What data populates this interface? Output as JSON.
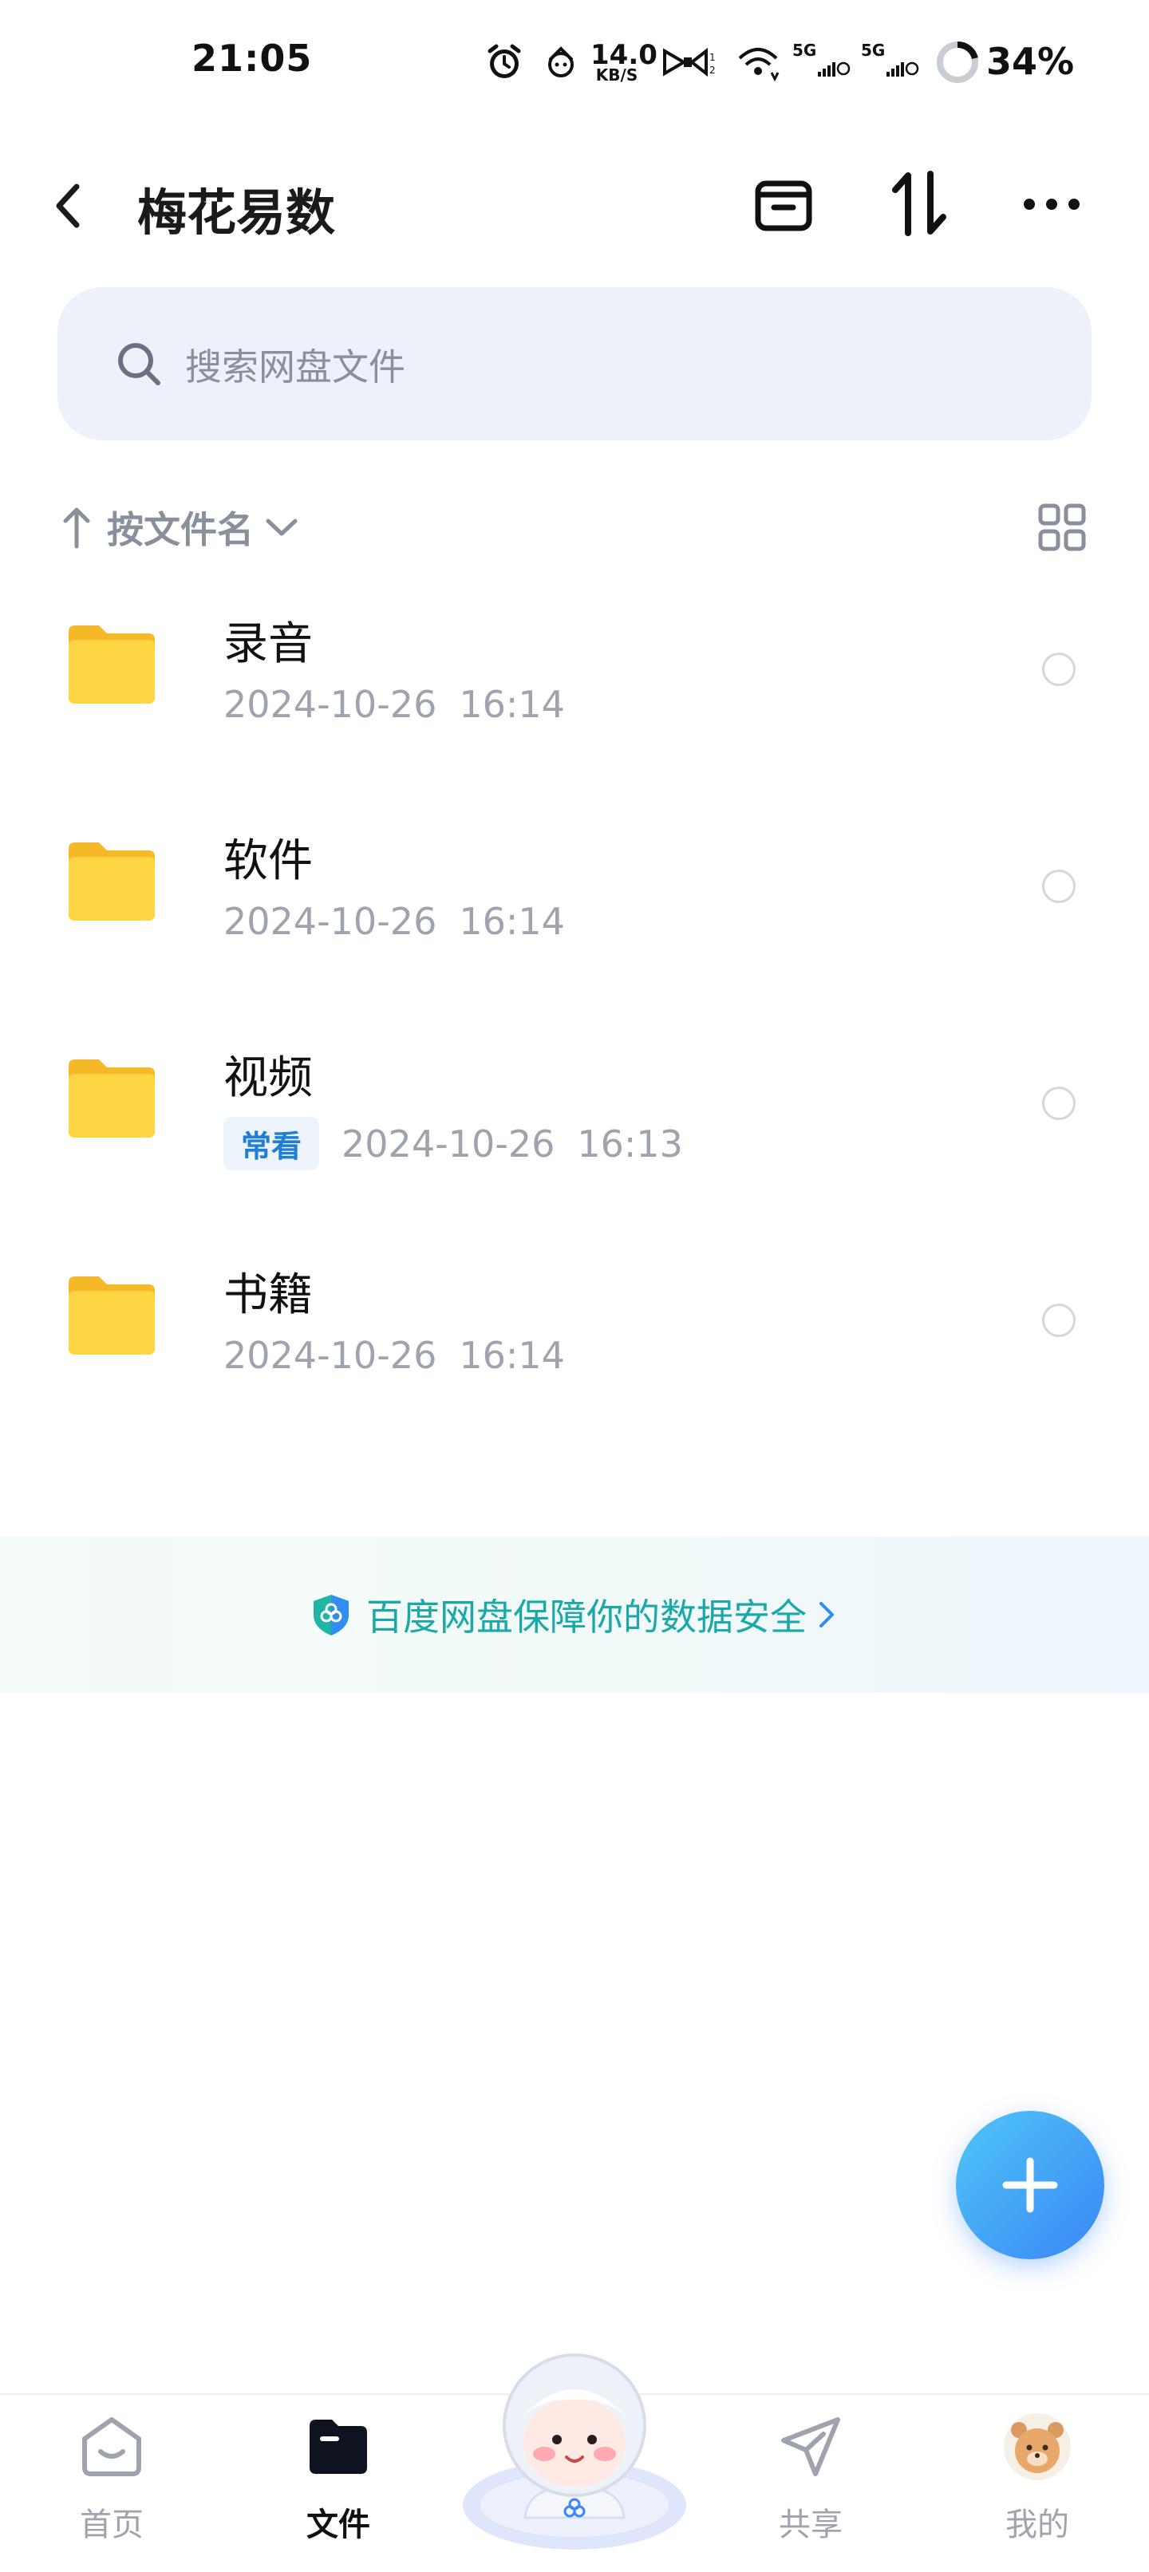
{
  "status_bar": {
    "time": "21:05",
    "net_speed_value": "14.0",
    "net_speed_unit": "KB/S",
    "battery": "34%",
    "icons": [
      "alarm-icon",
      "app-notification-icon",
      "bow-icon",
      "wifi-icon",
      "signal-5g-icon",
      "signal-5g-icon",
      "battery-ring-icon"
    ],
    "signal_label_1": "5G",
    "signal_label_2": "5G"
  },
  "header": {
    "title": "梅花易数",
    "icons": [
      "back-arrow-icon",
      "archive-icon",
      "sort-arrows-icon",
      "more-dots-icon"
    ]
  },
  "search": {
    "placeholder": "搜索网盘文件"
  },
  "sort": {
    "label": "按文件名"
  },
  "files": [
    {
      "name": "录音",
      "date": "2024-10-26",
      "time": "16:14",
      "tag": ""
    },
    {
      "name": "软件",
      "date": "2024-10-26",
      "time": "16:14",
      "tag": ""
    },
    {
      "name": "视频",
      "date": "2024-10-26",
      "time": "16:13",
      "tag": "常看"
    },
    {
      "name": "书籍",
      "date": "2024-10-26",
      "time": "16:14",
      "tag": ""
    }
  ],
  "banner": {
    "text": "百度网盘保障你的数据安全"
  },
  "nav": {
    "items": [
      {
        "label": "首页",
        "active": false
      },
      {
        "label": "文件",
        "active": true
      },
      {
        "label": "共享",
        "active": false
      },
      {
        "label": "我的",
        "active": false
      }
    ]
  },
  "colors": {
    "accent_blue": "#3b86f5",
    "folder_yellow": "#fcc93a",
    "banner_teal": "#1ba9a8",
    "tag_blue": "#1f7fd6",
    "muted_gray": "#9ea3ad"
  }
}
